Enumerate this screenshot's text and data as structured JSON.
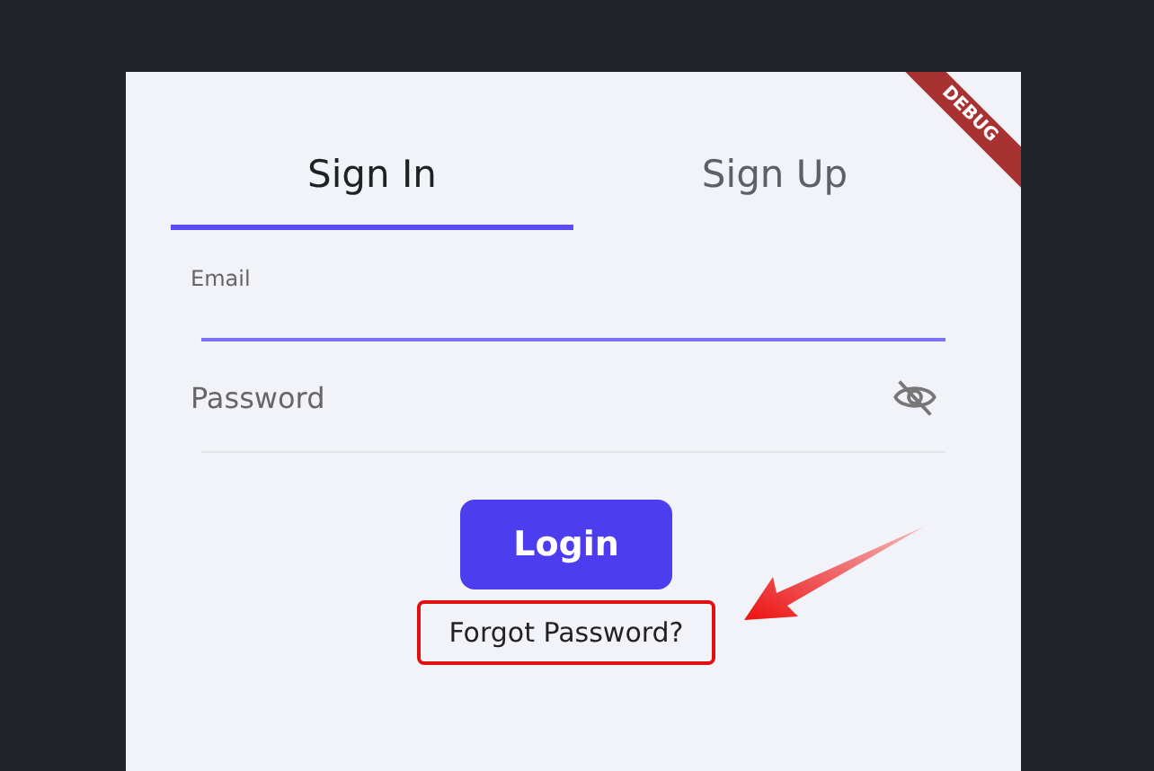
{
  "tabs": [
    {
      "label": "Sign In",
      "selected": true
    },
    {
      "label": "Sign Up",
      "selected": false
    }
  ],
  "email": {
    "label": "Email",
    "focused": true
  },
  "password": {
    "placeholder": "Password",
    "obscured": true
  },
  "login_button": {
    "label": "Login"
  },
  "forgot_link": {
    "label": "Forgot Password?",
    "highlighted": true
  },
  "debug_banner": {
    "label": "DEBUG"
  }
}
